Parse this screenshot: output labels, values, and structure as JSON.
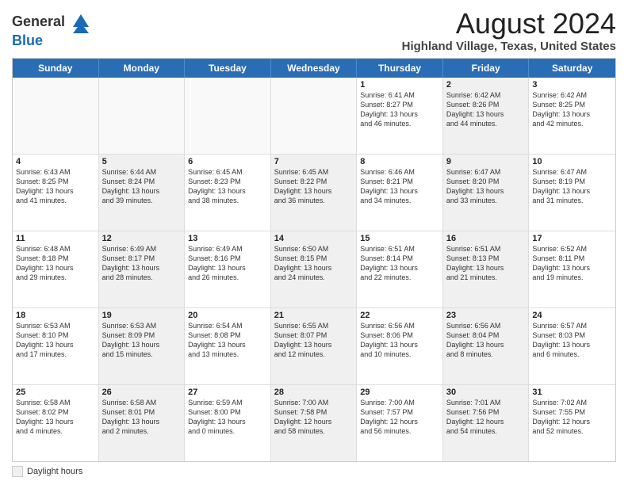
{
  "header": {
    "logo_line1": "General",
    "logo_line2": "Blue",
    "main_title": "August 2024",
    "subtitle": "Highland Village, Texas, United States"
  },
  "calendar": {
    "weekdays": [
      "Sunday",
      "Monday",
      "Tuesday",
      "Wednesday",
      "Thursday",
      "Friday",
      "Saturday"
    ],
    "weeks": [
      [
        {
          "day": "",
          "info": "",
          "shaded": false,
          "empty": true
        },
        {
          "day": "",
          "info": "",
          "shaded": false,
          "empty": true
        },
        {
          "day": "",
          "info": "",
          "shaded": false,
          "empty": true
        },
        {
          "day": "",
          "info": "",
          "shaded": false,
          "empty": true
        },
        {
          "day": "1",
          "info": "Sunrise: 6:41 AM\nSunset: 8:27 PM\nDaylight: 13 hours\nand 46 minutes.",
          "shaded": false,
          "empty": false
        },
        {
          "day": "2",
          "info": "Sunrise: 6:42 AM\nSunset: 8:26 PM\nDaylight: 13 hours\nand 44 minutes.",
          "shaded": true,
          "empty": false
        },
        {
          "day": "3",
          "info": "Sunrise: 6:42 AM\nSunset: 8:25 PM\nDaylight: 13 hours\nand 42 minutes.",
          "shaded": false,
          "empty": false
        }
      ],
      [
        {
          "day": "4",
          "info": "Sunrise: 6:43 AM\nSunset: 8:25 PM\nDaylight: 13 hours\nand 41 minutes.",
          "shaded": false,
          "empty": false
        },
        {
          "day": "5",
          "info": "Sunrise: 6:44 AM\nSunset: 8:24 PM\nDaylight: 13 hours\nand 39 minutes.",
          "shaded": true,
          "empty": false
        },
        {
          "day": "6",
          "info": "Sunrise: 6:45 AM\nSunset: 8:23 PM\nDaylight: 13 hours\nand 38 minutes.",
          "shaded": false,
          "empty": false
        },
        {
          "day": "7",
          "info": "Sunrise: 6:45 AM\nSunset: 8:22 PM\nDaylight: 13 hours\nand 36 minutes.",
          "shaded": true,
          "empty": false
        },
        {
          "day": "8",
          "info": "Sunrise: 6:46 AM\nSunset: 8:21 PM\nDaylight: 13 hours\nand 34 minutes.",
          "shaded": false,
          "empty": false
        },
        {
          "day": "9",
          "info": "Sunrise: 6:47 AM\nSunset: 8:20 PM\nDaylight: 13 hours\nand 33 minutes.",
          "shaded": true,
          "empty": false
        },
        {
          "day": "10",
          "info": "Sunrise: 6:47 AM\nSunset: 8:19 PM\nDaylight: 13 hours\nand 31 minutes.",
          "shaded": false,
          "empty": false
        }
      ],
      [
        {
          "day": "11",
          "info": "Sunrise: 6:48 AM\nSunset: 8:18 PM\nDaylight: 13 hours\nand 29 minutes.",
          "shaded": false,
          "empty": false
        },
        {
          "day": "12",
          "info": "Sunrise: 6:49 AM\nSunset: 8:17 PM\nDaylight: 13 hours\nand 28 minutes.",
          "shaded": true,
          "empty": false
        },
        {
          "day": "13",
          "info": "Sunrise: 6:49 AM\nSunset: 8:16 PM\nDaylight: 13 hours\nand 26 minutes.",
          "shaded": false,
          "empty": false
        },
        {
          "day": "14",
          "info": "Sunrise: 6:50 AM\nSunset: 8:15 PM\nDaylight: 13 hours\nand 24 minutes.",
          "shaded": true,
          "empty": false
        },
        {
          "day": "15",
          "info": "Sunrise: 6:51 AM\nSunset: 8:14 PM\nDaylight: 13 hours\nand 22 minutes.",
          "shaded": false,
          "empty": false
        },
        {
          "day": "16",
          "info": "Sunrise: 6:51 AM\nSunset: 8:13 PM\nDaylight: 13 hours\nand 21 minutes.",
          "shaded": true,
          "empty": false
        },
        {
          "day": "17",
          "info": "Sunrise: 6:52 AM\nSunset: 8:11 PM\nDaylight: 13 hours\nand 19 minutes.",
          "shaded": false,
          "empty": false
        }
      ],
      [
        {
          "day": "18",
          "info": "Sunrise: 6:53 AM\nSunset: 8:10 PM\nDaylight: 13 hours\nand 17 minutes.",
          "shaded": false,
          "empty": false
        },
        {
          "day": "19",
          "info": "Sunrise: 6:53 AM\nSunset: 8:09 PM\nDaylight: 13 hours\nand 15 minutes.",
          "shaded": true,
          "empty": false
        },
        {
          "day": "20",
          "info": "Sunrise: 6:54 AM\nSunset: 8:08 PM\nDaylight: 13 hours\nand 13 minutes.",
          "shaded": false,
          "empty": false
        },
        {
          "day": "21",
          "info": "Sunrise: 6:55 AM\nSunset: 8:07 PM\nDaylight: 13 hours\nand 12 minutes.",
          "shaded": true,
          "empty": false
        },
        {
          "day": "22",
          "info": "Sunrise: 6:56 AM\nSunset: 8:06 PM\nDaylight: 13 hours\nand 10 minutes.",
          "shaded": false,
          "empty": false
        },
        {
          "day": "23",
          "info": "Sunrise: 6:56 AM\nSunset: 8:04 PM\nDaylight: 13 hours\nand 8 minutes.",
          "shaded": true,
          "empty": false
        },
        {
          "day": "24",
          "info": "Sunrise: 6:57 AM\nSunset: 8:03 PM\nDaylight: 13 hours\nand 6 minutes.",
          "shaded": false,
          "empty": false
        }
      ],
      [
        {
          "day": "25",
          "info": "Sunrise: 6:58 AM\nSunset: 8:02 PM\nDaylight: 13 hours\nand 4 minutes.",
          "shaded": false,
          "empty": false
        },
        {
          "day": "26",
          "info": "Sunrise: 6:58 AM\nSunset: 8:01 PM\nDaylight: 13 hours\nand 2 minutes.",
          "shaded": true,
          "empty": false
        },
        {
          "day": "27",
          "info": "Sunrise: 6:59 AM\nSunset: 8:00 PM\nDaylight: 13 hours\nand 0 minutes.",
          "shaded": false,
          "empty": false
        },
        {
          "day": "28",
          "info": "Sunrise: 7:00 AM\nSunset: 7:58 PM\nDaylight: 12 hours\nand 58 minutes.",
          "shaded": true,
          "empty": false
        },
        {
          "day": "29",
          "info": "Sunrise: 7:00 AM\nSunset: 7:57 PM\nDaylight: 12 hours\nand 56 minutes.",
          "shaded": false,
          "empty": false
        },
        {
          "day": "30",
          "info": "Sunrise: 7:01 AM\nSunset: 7:56 PM\nDaylight: 12 hours\nand 54 minutes.",
          "shaded": true,
          "empty": false
        },
        {
          "day": "31",
          "info": "Sunrise: 7:02 AM\nSunset: 7:55 PM\nDaylight: 12 hours\nand 52 minutes.",
          "shaded": false,
          "empty": false
        }
      ]
    ]
  },
  "footer": {
    "daylight_label": "Daylight hours"
  }
}
